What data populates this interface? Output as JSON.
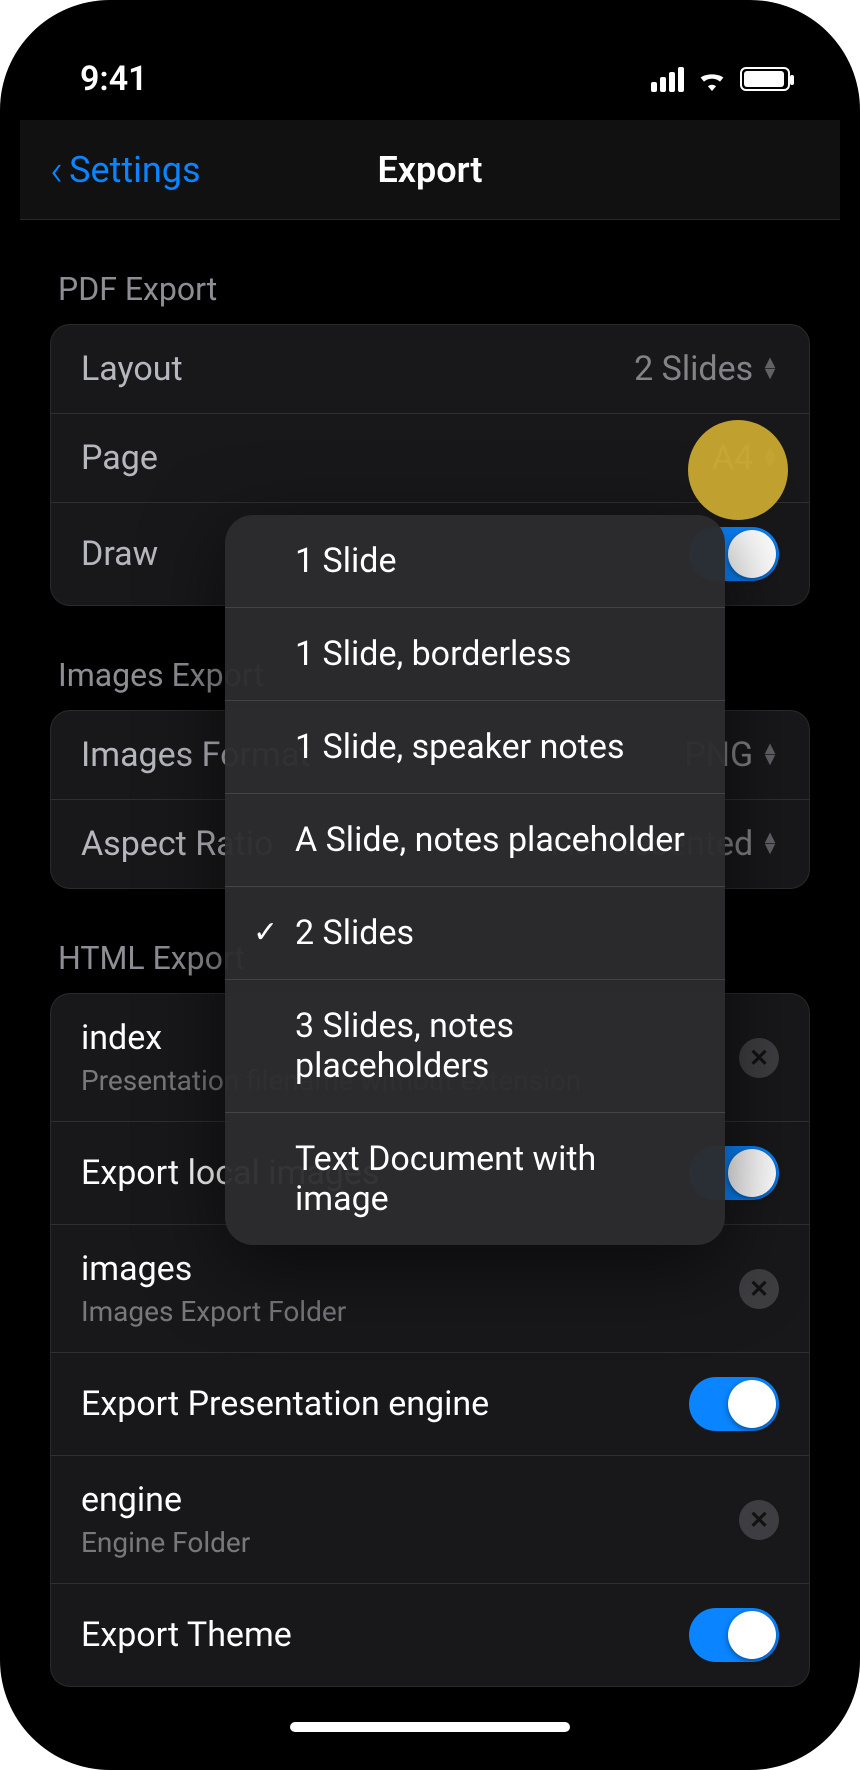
{
  "statusbar": {
    "time": "9:41"
  },
  "navbar": {
    "back_label": "Settings",
    "title": "Export"
  },
  "sections": {
    "pdf": {
      "header": "PDF Export",
      "layout_label": "Layout",
      "layout_value": "2 Slides",
      "page_label": "Page",
      "page_value": "A4",
      "draw_label": "Draw",
      "layout_options": [
        "1 Slide",
        "1 Slide, borderless",
        "1 Slide, speaker notes",
        "A Slide, notes placeholder",
        "2 Slides",
        "3 Slides, notes placeholders",
        "Text Document with image"
      ],
      "layout_selected_index": 4
    },
    "images": {
      "header": "Images Export",
      "format_label": "Images Format",
      "format_value": "PNG",
      "aspect_label": "Aspect Ratio",
      "aspect_value": "As Presented"
    },
    "html": {
      "header": "HTML Export",
      "index_label": "index",
      "index_subtitle": "Presentation filename without extension",
      "export_local_images_label": "Export local images",
      "images_folder_label": "images",
      "images_folder_subtitle": "Images Export Folder",
      "export_engine_label": "Export Presentation engine",
      "engine_folder_label": "engine",
      "engine_folder_subtitle": "Engine Folder",
      "export_theme_label": "Export Theme"
    }
  }
}
